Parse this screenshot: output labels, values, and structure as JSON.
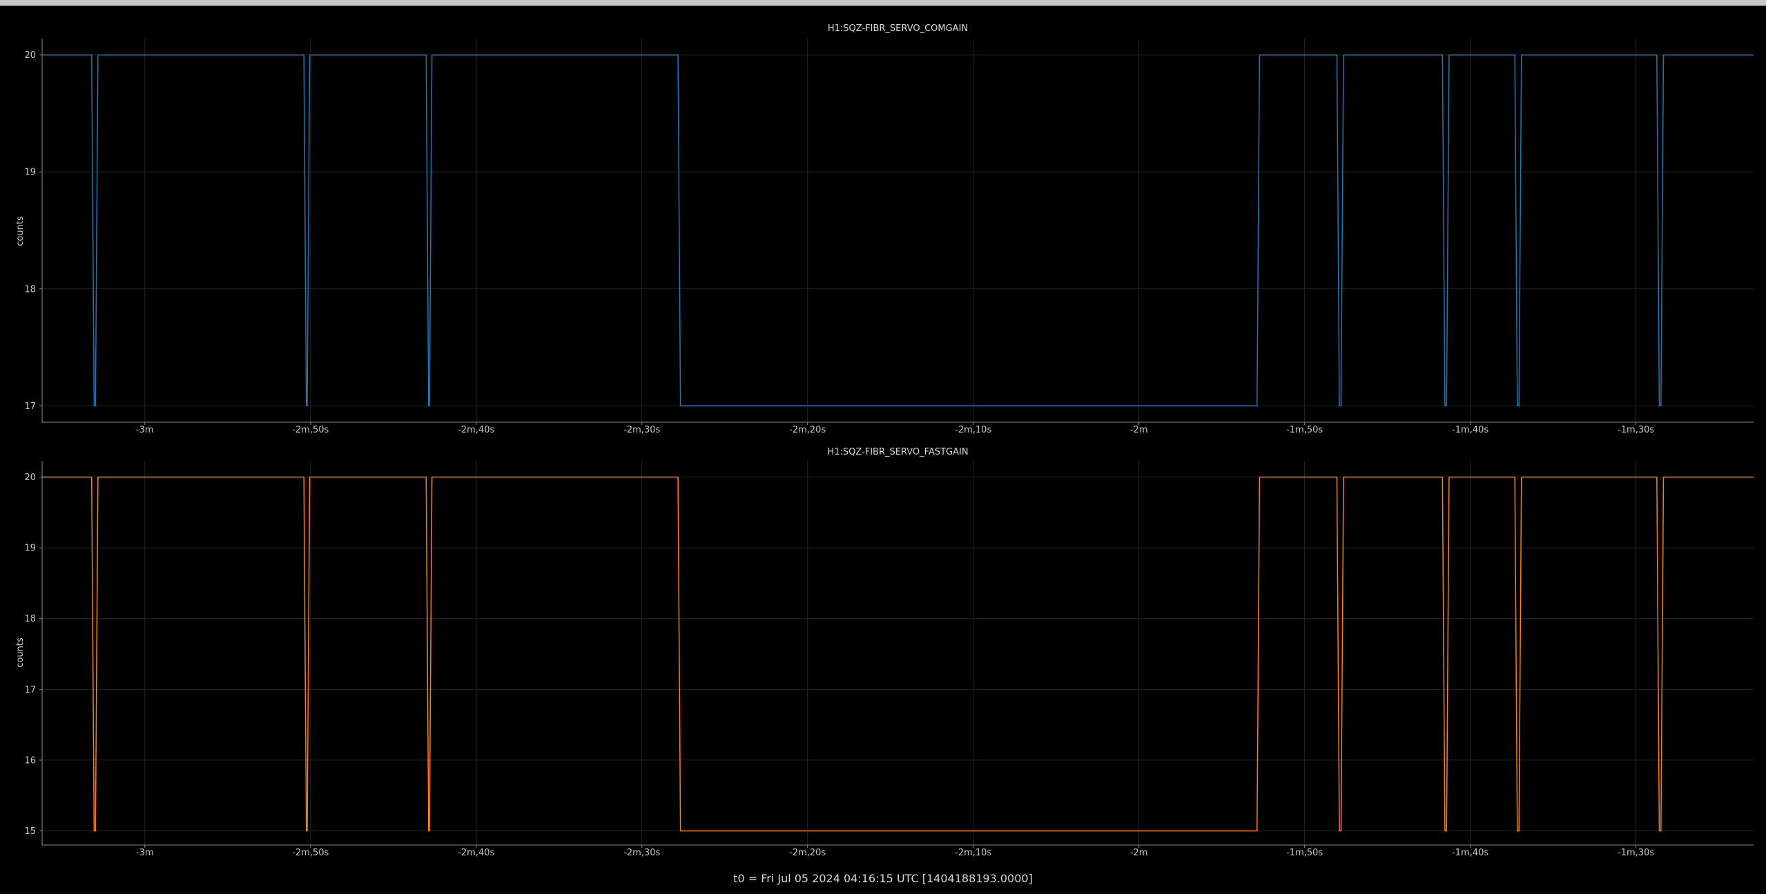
{
  "footer": "t0 = Fri Jul 05 2024 04:16:15 UTC [1404188193.0000]",
  "chart_data": [
    {
      "type": "line",
      "title": "H1:SQZ-FIBR_SERVO_COMGAIN",
      "ylabel": "counts",
      "xlim": [
        -190.2,
        -86.9
      ],
      "ylim": [
        16.86,
        20.14
      ],
      "yticks": [
        17,
        18,
        19,
        20
      ],
      "xticks": [
        -184,
        -174,
        -164,
        -154,
        -144,
        -134,
        -124,
        -114,
        -104,
        -94
      ],
      "xtick_labels": [
        "-3m",
        "-2m,50s",
        "-2m,40s",
        "-2m,30s",
        "-2m,20s",
        "-2m,10s",
        "-2m",
        "-1m,50s",
        "-1m,40s",
        "-1m,30s"
      ],
      "grid": true,
      "series": [
        {
          "color": "#1f77b4",
          "x": [
            -190.2,
            -187.21,
            -187.06,
            -186.98,
            -186.83,
            -174.4,
            -174.25,
            -174.2,
            -174.05,
            -167.02,
            -166.87,
            -166.82,
            -166.67,
            -151.82,
            -151.67,
            -116.87,
            -116.72,
            -112.05,
            -111.9,
            -111.8,
            -111.65,
            -105.68,
            -105.53,
            -105.43,
            -105.28,
            -101.31,
            -101.16,
            -101.06,
            -100.91,
            -92.74,
            -92.59,
            -92.49,
            -92.34,
            -86.9
          ],
          "y": [
            20,
            20,
            17,
            17,
            20,
            20,
            17,
            17,
            20,
            20,
            17,
            17,
            20,
            20,
            17,
            17,
            20,
            20,
            17,
            17,
            20,
            20,
            17,
            17,
            20,
            20,
            17,
            17,
            20,
            20,
            17,
            17,
            20,
            20
          ]
        }
      ]
    },
    {
      "type": "line",
      "title": "H1:SQZ-FIBR_SERVO_FASTGAIN",
      "ylabel": "counts",
      "xlim": [
        -190.2,
        -86.9
      ],
      "ylim": [
        14.8,
        20.23
      ],
      "yticks": [
        15,
        16,
        17,
        18,
        19,
        20
      ],
      "xticks": [
        -184,
        -174,
        -164,
        -154,
        -144,
        -134,
        -124,
        -114,
        -104,
        -94
      ],
      "xtick_labels": [
        "-3m",
        "-2m,50s",
        "-2m,40s",
        "-2m,30s",
        "-2m,20s",
        "-2m,10s",
        "-2m",
        "-1m,50s",
        "-1m,40s",
        "-1m,30s"
      ],
      "grid": true,
      "series": [
        {
          "color": "#ff7f0e",
          "x": [
            -190.2,
            -187.21,
            -187.06,
            -186.98,
            -186.83,
            -174.4,
            -174.25,
            -174.2,
            -174.05,
            -167.02,
            -166.87,
            -166.82,
            -166.67,
            -151.82,
            -151.67,
            -116.87,
            -116.72,
            -112.05,
            -111.9,
            -111.8,
            -111.65,
            -105.68,
            -105.53,
            -105.43,
            -105.28,
            -101.31,
            -101.16,
            -101.06,
            -100.91,
            -92.74,
            -92.59,
            -92.49,
            -92.34,
            -86.9
          ],
          "y": [
            20,
            20,
            15,
            15,
            20,
            20,
            15,
            15,
            20,
            20,
            15,
            15,
            20,
            20,
            15,
            15,
            20,
            20,
            15,
            15,
            20,
            20,
            15,
            15,
            20,
            20,
            15,
            15,
            20,
            20,
            15,
            15,
            20,
            20
          ]
        }
      ]
    }
  ]
}
